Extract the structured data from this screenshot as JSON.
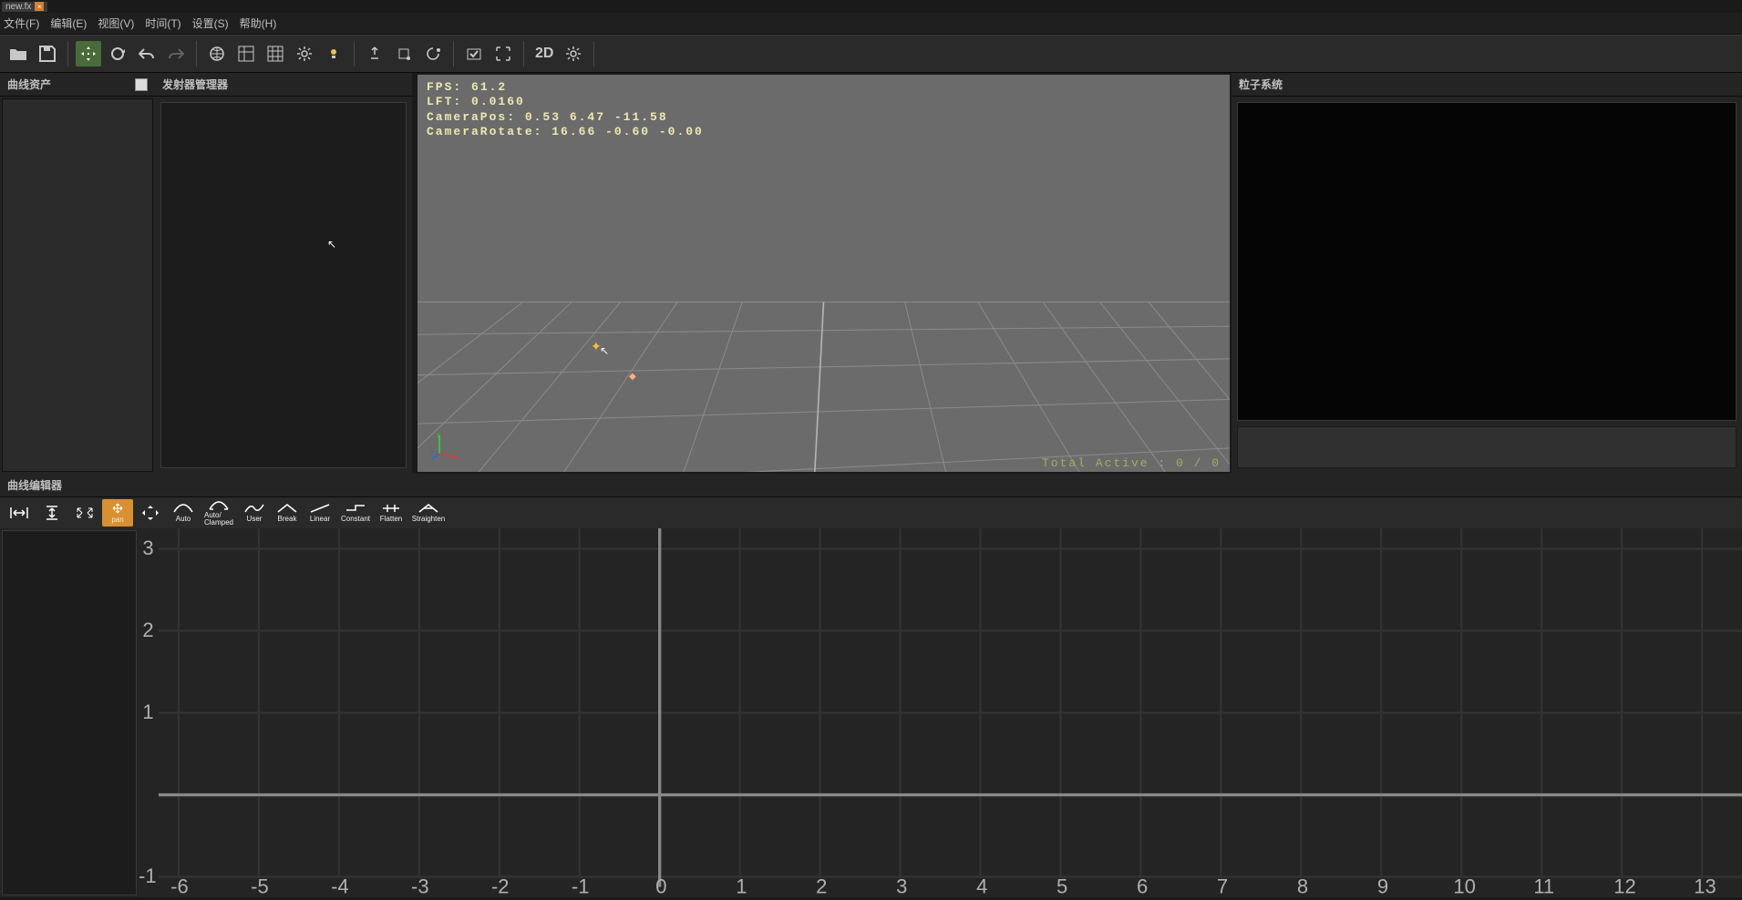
{
  "file_tab": {
    "name": "new.fx",
    "close": "×"
  },
  "menu": {
    "file": "文件(F)",
    "edit": "编辑(E)",
    "view": "视图(V)",
    "time": "时间(T)",
    "settings": "设置(S)",
    "help": "帮助(H)"
  },
  "toolbar": {
    "mode_2d": "2D"
  },
  "panels": {
    "curve_asset": "曲线资产",
    "emitter_manager": "发射器管理器",
    "particle_system": "粒子系统",
    "curve_editor": "曲线编辑器"
  },
  "viewport": {
    "fps_label": "FPS:",
    "fps": "61.2",
    "lft_label": "LFT:",
    "lft": "0.0160",
    "campos_label": "CameraPos:",
    "campos": "0.53 6.47 -11.58",
    "camrot_label": "CameraRotate:",
    "camrot": "16.66 -0.60 -0.00",
    "total_active": "Total Active : 0 / 0",
    "axis_x": "x",
    "axis_y": "y",
    "axis_z": "z"
  },
  "curve_buttons": {
    "fit_h": "",
    "fit_v": "",
    "fit_all": "",
    "pan": "pan",
    "move": "",
    "auto": "Auto",
    "auto_clamped": "Auto/\nClamped",
    "user": "User",
    "break": "Break",
    "linear": "Linear",
    "constant": "Constant",
    "flatten": "Flatten",
    "straighten": "Straighten"
  },
  "curve_axis": {
    "y": [
      "3",
      "2",
      "1",
      "-1"
    ],
    "x": [
      "-6",
      "-5",
      "-4",
      "-3",
      "-2",
      "-1",
      "0",
      "1",
      "2",
      "3",
      "4",
      "5",
      "6",
      "7",
      "8",
      "9",
      "10",
      "11",
      "12",
      "13"
    ]
  }
}
